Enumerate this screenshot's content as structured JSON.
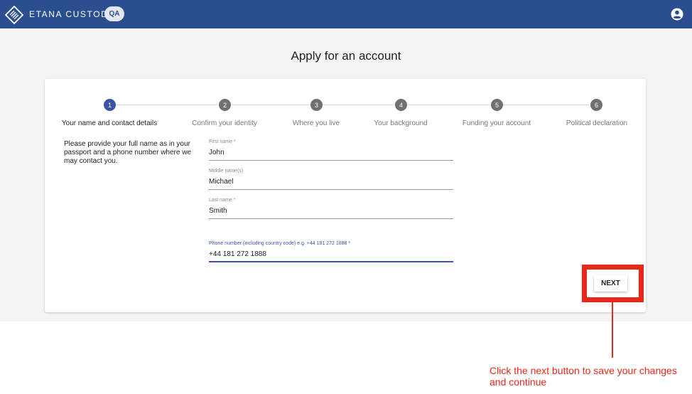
{
  "header": {
    "brand": "ETANA CUSTODY",
    "env_badge": "QA",
    "colors": {
      "bar": "#2b4f8e",
      "accent": "#3955a3"
    },
    "account_icon": "account-circle-icon"
  },
  "page_title": "Apply for an account",
  "steps": [
    {
      "number": "1",
      "label": "Your name and contact details",
      "active": true
    },
    {
      "number": "2",
      "label": "Confirm your identity",
      "active": false
    },
    {
      "number": "3",
      "label": "Where you live",
      "active": false
    },
    {
      "number": "4",
      "label": "Your background",
      "active": false
    },
    {
      "number": "5",
      "label": "Funding your account",
      "active": false
    },
    {
      "number": "6",
      "label": "Political declaration",
      "active": false
    }
  ],
  "instructions": "Please provide your full name as in your passport and a phone number where we may contact you.",
  "fields": {
    "first_name": {
      "label": "First name *",
      "value": "John"
    },
    "middle_name": {
      "label": "Middle name(s)",
      "value": "Michael"
    },
    "last_name": {
      "label": "Last name *",
      "value": "Smith"
    },
    "phone": {
      "label": "Phone number (including country code) e.g. +44 181 272 1888 *",
      "value": "+44 181 272 1888"
    }
  },
  "actions": {
    "next_label": "NEXT"
  },
  "annotation": {
    "text": "Click the next button to save your changes and continue",
    "color": "#e8281a"
  }
}
